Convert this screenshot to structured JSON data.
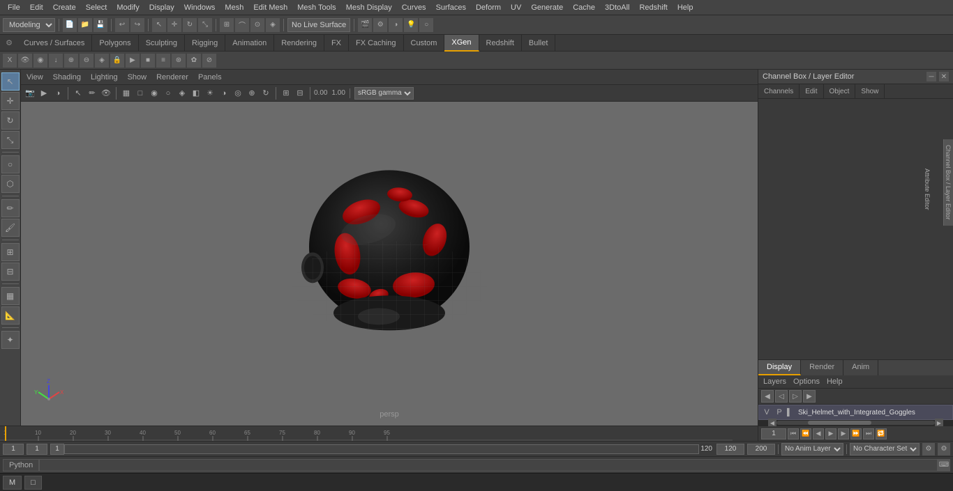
{
  "menuBar": {
    "items": [
      "File",
      "Edit",
      "Create",
      "Select",
      "Modify",
      "Display",
      "Windows",
      "Mesh",
      "Edit Mesh",
      "Mesh Tools",
      "Mesh Display",
      "Curves",
      "Surfaces",
      "Deform",
      "UV",
      "Generate",
      "Cache",
      "3DtoAll",
      "Redshift",
      "Help"
    ]
  },
  "toolbar1": {
    "modeSelect": "Modeling",
    "noLiveSurface": "No Live Surface"
  },
  "workspaceTabs": {
    "items": [
      "Curves / Surfaces",
      "Polygons",
      "Sculpting",
      "Rigging",
      "Animation",
      "Rendering",
      "FX",
      "FX Caching",
      "Custom",
      "XGen",
      "Redshift",
      "Bullet"
    ],
    "active": "XGen"
  },
  "viewport": {
    "menuItems": [
      "View",
      "Shading",
      "Lighting",
      "Show",
      "Renderer",
      "Panels"
    ],
    "perspLabel": "persp",
    "colorProfile": "sRGB gamma",
    "coordX": "0.00",
    "coordY": "1.00"
  },
  "channelBox": {
    "title": "Channel Box / Layer Editor",
    "tabs": [
      "Channels",
      "Edit",
      "Object",
      "Show"
    ]
  },
  "displayRenderTabs": {
    "items": [
      "Display",
      "Render",
      "Anim"
    ],
    "active": "Display"
  },
  "layers": {
    "title": "Layers",
    "menuItems": [
      "Layers",
      "Options",
      "Help"
    ],
    "layerName": "Ski_Helmet_with_Integrated_Goggles",
    "v": "V",
    "p": "P"
  },
  "timeline": {
    "start": "1",
    "end": "120",
    "currentFrame": "1",
    "rangeStart": "1",
    "rangeEnd": "120",
    "maxTime": "200"
  },
  "bottomBar": {
    "frame1": "1",
    "frame2": "1",
    "frame3": "1",
    "rangeEnd": "120",
    "timeEnd": "120",
    "maxEnd": "200",
    "noAnimLayer": "No Anim Layer",
    "noCharSet": "No Character Set"
  },
  "pythonBar": {
    "label": "Python"
  },
  "taskbar": {
    "items": [
      "Maya",
      ""
    ]
  },
  "rightEdge": {
    "tabs": [
      "Channel Box / Layer Editor",
      "Attribute Editor"
    ]
  }
}
